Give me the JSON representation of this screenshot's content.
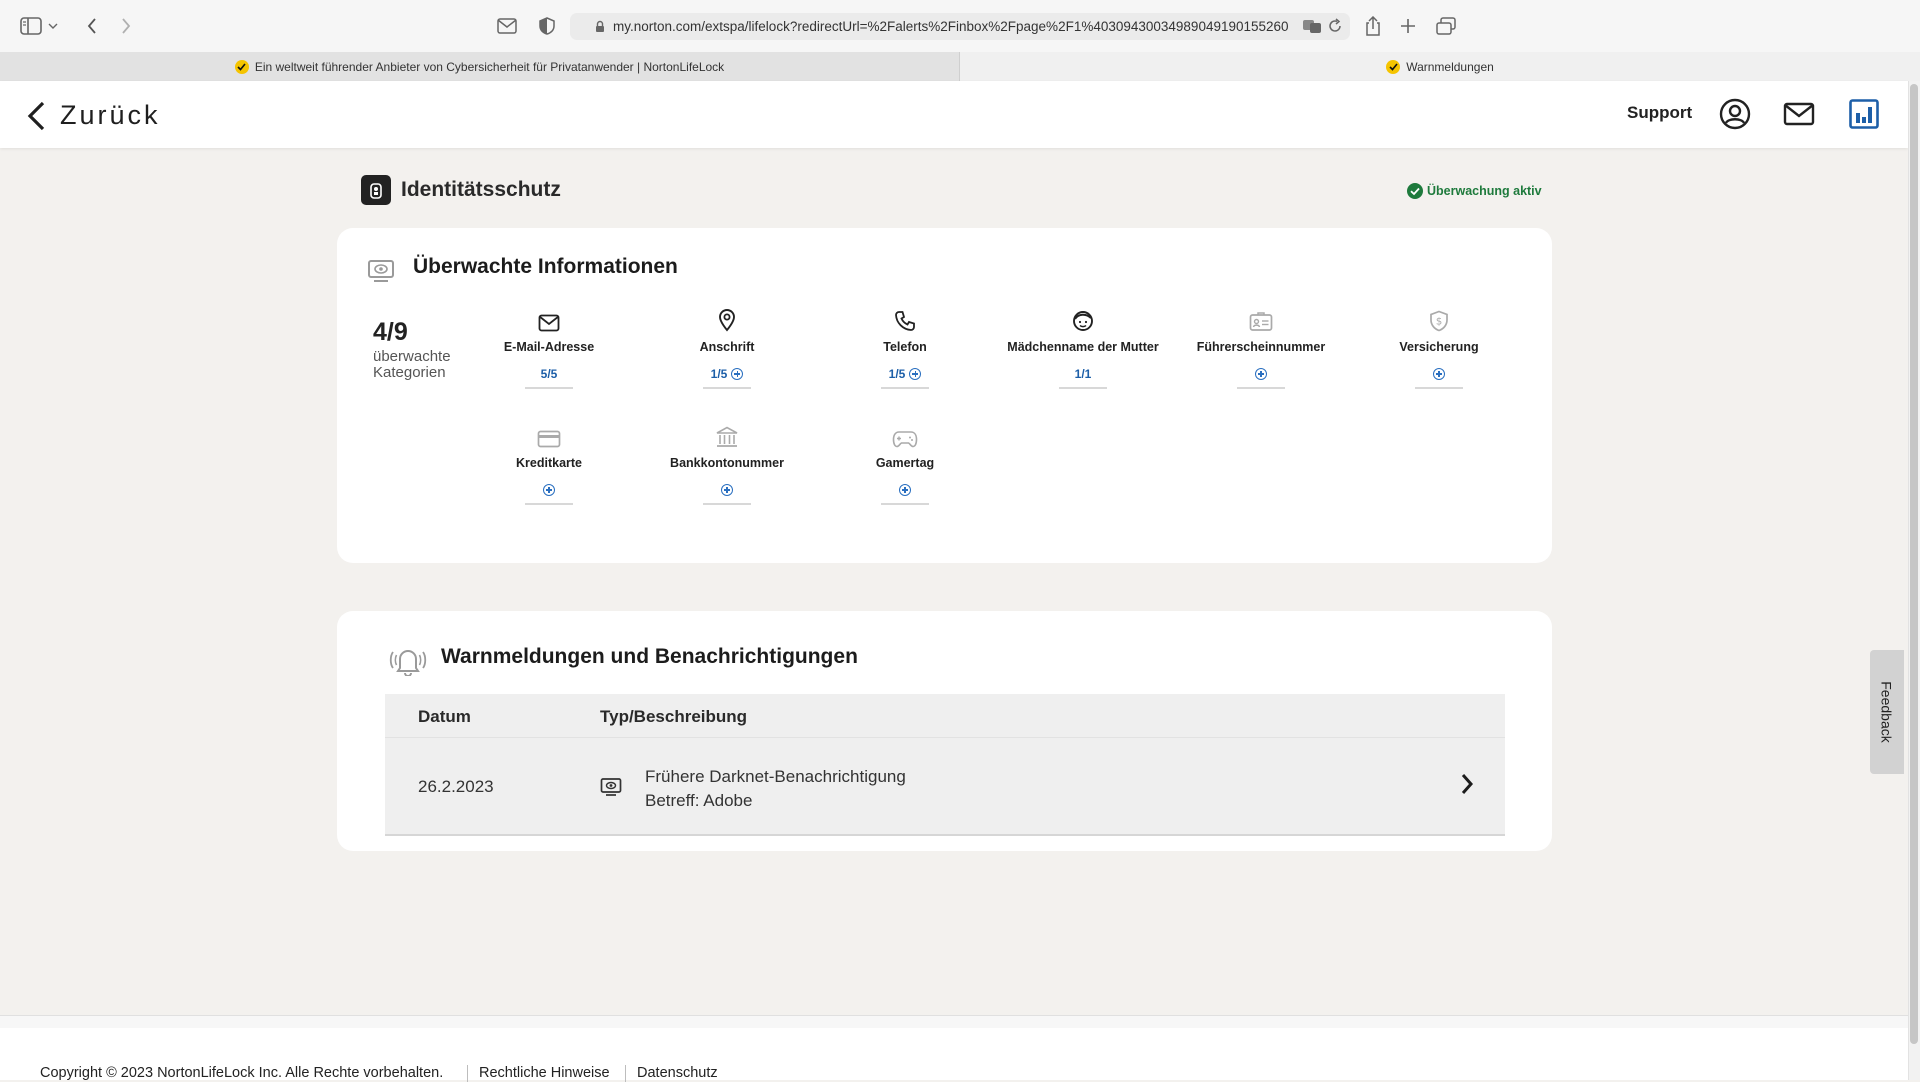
{
  "browser": {
    "url": "my.norton.com/extspa/lifelock?redirectUrl=%2Falerts%2Finbox%2Fpage%2F1%40309430034989049190155260",
    "tabs": [
      {
        "label": "Ein weltweit führender Anbieter von Cybersicherheit für Privatanwender | NortonLifeLock"
      },
      {
        "label": "Warnmeldungen"
      }
    ]
  },
  "header": {
    "back_label": "Zurück",
    "support_label": "Support"
  },
  "identity": {
    "title": "Identitätsschutz",
    "status": "Überwachung aktiv"
  },
  "monitored": {
    "title": "Überwachte Informationen",
    "count": "4/9",
    "count_label": "überwachte Kategorien",
    "categories": [
      {
        "label": "E-Mail-Adresse",
        "value": "5/5",
        "icon": "mail-icon"
      },
      {
        "label": "Anschrift",
        "value": "1/5",
        "icon": "location-pin-icon"
      },
      {
        "label": "Telefon",
        "value": "1/5",
        "icon": "phone-icon"
      },
      {
        "label": "Mädchenname der Mutter",
        "value": "1/1",
        "icon": "face-icon"
      },
      {
        "label": "Führerscheinnummer",
        "value": "",
        "icon": "id-card-icon"
      },
      {
        "label": "Versicherung",
        "value": "",
        "icon": "shield-dollar-icon"
      },
      {
        "label": "Kreditkarte",
        "value": "",
        "icon": "credit-card-icon"
      },
      {
        "label": "Bankkontonummer",
        "value": "",
        "icon": "bank-icon"
      },
      {
        "label": "Gamertag",
        "value": "",
        "icon": "gamepad-icon"
      }
    ]
  },
  "alerts": {
    "title": "Warnmeldungen und Benachrichtigungen",
    "columns": [
      "Datum",
      "Typ/Beschreibung"
    ],
    "rows": [
      {
        "date": "26.2.2023",
        "line1": "Frühere Darknet-Benachrichtigung",
        "line2": "Betreff: Adobe"
      }
    ]
  },
  "feedback_label": "Feedback",
  "footer": {
    "copyright": "Copyright © 2023 NortonLifeLock Inc. Alle Rechte vorbehalten.",
    "links": [
      "Rechtliche Hinweise",
      "Datenschutz"
    ]
  },
  "colors": {
    "accent": "#1d5fa8",
    "status_green": "#1e7a3c",
    "page_bg": "#f3f1ee"
  }
}
